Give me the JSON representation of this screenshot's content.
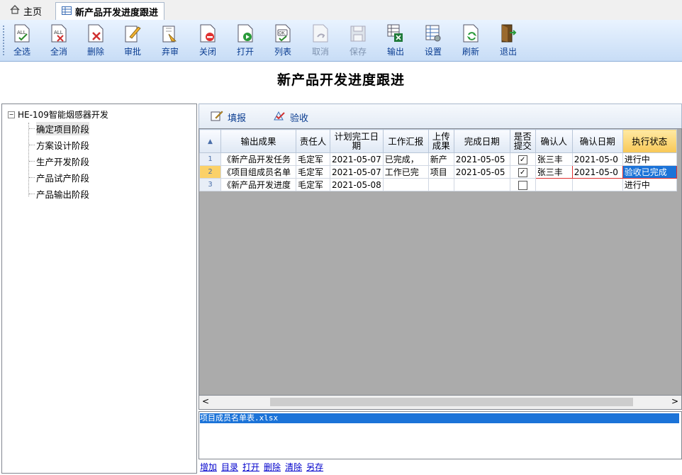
{
  "tabs": {
    "home": "主页",
    "active": "新产品开发进度跟进"
  },
  "toolbar": [
    {
      "label": "全选",
      "icon": "select-all-icon"
    },
    {
      "label": "全消",
      "icon": "deselect-all-icon"
    },
    {
      "label": "删除",
      "icon": "delete-icon"
    },
    {
      "label": "审批",
      "icon": "approve-icon"
    },
    {
      "label": "弃审",
      "icon": "unapprove-icon"
    },
    {
      "label": "关闭",
      "icon": "close-doc-icon"
    },
    {
      "label": "打开",
      "icon": "open-doc-icon"
    },
    {
      "label": "列表",
      "icon": "list-icon"
    },
    {
      "label": "取消",
      "icon": "cancel-icon",
      "disabled": true
    },
    {
      "label": "保存",
      "icon": "save-icon",
      "disabled": true
    },
    {
      "label": "输出",
      "icon": "export-icon"
    },
    {
      "label": "设置",
      "icon": "settings-icon"
    },
    {
      "label": "刷新",
      "icon": "refresh-icon"
    },
    {
      "label": "退出",
      "icon": "exit-icon"
    }
  ],
  "page_title": "新产品开发进度跟进",
  "tree": {
    "root": "HE-109智能烟感器开发",
    "items": [
      "确定项目阶段",
      "方案设计阶段",
      "生产开发阶段",
      "产品试产阶段",
      "产品输出阶段"
    ],
    "selected": 0
  },
  "subtoolbar": {
    "fill": "填报",
    "accept": "验收"
  },
  "grid": {
    "columns": [
      "输出成果",
      "责任人",
      "计划完工日期",
      "工作汇报",
      "上传成果",
      "完成日期",
      "是否提交",
      "确认人",
      "确认日期",
      "执行状态"
    ],
    "rows": [
      {
        "n": "1",
        "output": "《新产品开发任务",
        "owner": "毛定军",
        "plan": "2021-05-07",
        "report": "已完成，",
        "upload": "新产",
        "done": "2021-05-05",
        "submitted": true,
        "confirmer": "张三丰",
        "confirm_date": "2021-05-0",
        "status": "进行中"
      },
      {
        "n": "2",
        "output": "《项目组成员名单",
        "owner": "毛定军",
        "plan": "2021-05-07",
        "report": "工作已完",
        "upload": "项目",
        "done": "2021-05-05",
        "submitted": true,
        "confirmer": "张三丰",
        "confirm_date": "2021-05-0",
        "status": "验收已完成"
      },
      {
        "n": "3",
        "output": "《新产品开发进度",
        "owner": "毛定军",
        "plan": "2021-05-08",
        "report": "",
        "upload": "",
        "done": "",
        "submitted": false,
        "confirmer": "",
        "confirm_date": "",
        "status": "进行中"
      }
    ]
  },
  "files": [
    "项目成员名单表.xlsx"
  ],
  "file_links": [
    "增加",
    "目录",
    "打开",
    "删除",
    "清除",
    "另存"
  ],
  "colors": {
    "selection": "#1b73d8",
    "status_header": "#f8c857",
    "toolbar_text": "#0b3d91"
  }
}
